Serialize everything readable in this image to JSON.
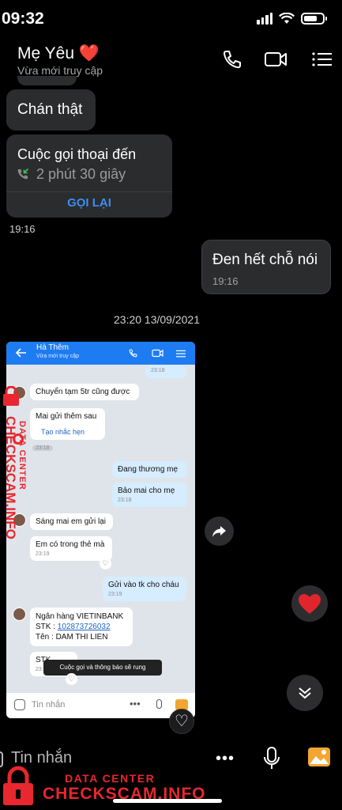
{
  "status": {
    "time": "09:32"
  },
  "header": {
    "name": "Mẹ Yêu",
    "heart": "❤️",
    "status": "Vừa mới truy cập",
    "icons": [
      "phone-icon",
      "video-camera-icon",
      "menu-list-icon"
    ]
  },
  "messages": {
    "m1": {
      "text": "Chán thật"
    },
    "call": {
      "title": "Cuộc gọi thoại đến",
      "duration": "2 phút 30 giây",
      "action": "GỌI LẠI",
      "time": "19:16"
    },
    "m2": {
      "text": "Đen hết chỗ nói",
      "time": "19:16"
    },
    "divider": "23:20 13/09/2021"
  },
  "screenshot": {
    "contact": "Hà Thêm",
    "status": "Vừa mới truy cập",
    "top_time": "23:18",
    "b1": "Chuyển tạm 5tr cũng được",
    "b2": "Mai gửi thêm sau",
    "b2_link": "Tạo nhắc hẹn",
    "b2_time": "23:18",
    "b3": "Đang thương mẹ",
    "b4": "Bảo mai cho mẹ",
    "b4_time": "23:18",
    "b5": "Sáng mai em gửi lại",
    "b6": "Em có trong thẻ mà",
    "b6_time": "23:19",
    "b7": "Gửi vào tk cho cháu",
    "b7_time": "23:19",
    "bank_line1": "Ngân hàng VIETINBANK",
    "bank_stk_label": "STK : ",
    "bank_stk": "102873726032",
    "bank_name": "Tên : DAM THI LIEN",
    "b9": "STK",
    "b9_time": "23:",
    "toast": "Cuộc gọi và thông báo sẽ rung",
    "input_placeholder": "Tin nhắn"
  },
  "watermark": {
    "top": "DATA CENTER",
    "bottom": "CHECKSCAM.INFO"
  },
  "bottom": {
    "placeholder": "Tin nhắn"
  },
  "colors": {
    "accent": "#2f8cf7",
    "heart": "#e0262c",
    "watermark": "#e8272e"
  }
}
